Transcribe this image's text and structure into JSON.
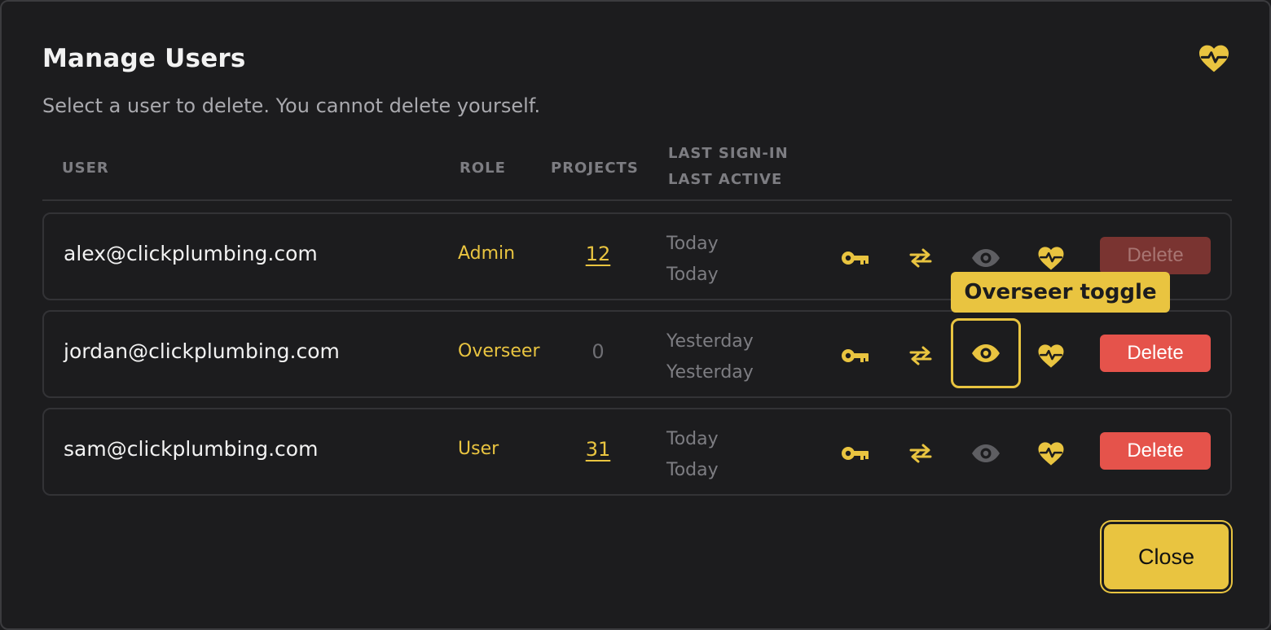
{
  "dialog": {
    "title": "Manage Users",
    "subtitle": "Select a user to delete. You cannot delete yourself.",
    "header_icon": "heart-pulse-icon"
  },
  "columns": {
    "user": "USER",
    "role": "ROLE",
    "projects": "PROJECTS",
    "last_sign_in": "LAST SIGN-IN",
    "last_active": "LAST ACTIVE"
  },
  "users": [
    {
      "email": "alex@clickplumbing.com",
      "role": "Admin",
      "projects": "12",
      "last_sign_in": "Today",
      "last_active": "Today",
      "overseer": false,
      "delete_label": "Delete",
      "delete_disabled": true
    },
    {
      "email": "jordan@clickplumbing.com",
      "role": "Overseer",
      "projects": "0",
      "last_sign_in": "Yesterday",
      "last_active": "Yesterday",
      "overseer": true,
      "delete_label": "Delete",
      "delete_disabled": false
    },
    {
      "email": "sam@clickplumbing.com",
      "role": "User",
      "projects": "31",
      "last_sign_in": "Today",
      "last_active": "Today",
      "overseer": false,
      "delete_label": "Delete",
      "delete_disabled": false
    }
  ],
  "row_icons": [
    "key-icon",
    "swap-icon",
    "eye-icon",
    "heart-pulse-icon"
  ],
  "tooltip": "Overseer toggle",
  "close_label": "Close",
  "colors": {
    "accent": "#e9c440",
    "danger": "#e5534b",
    "danger_disabled": "#7a3431",
    "background": "#1c1c1e",
    "muted": "#7d7d82"
  }
}
